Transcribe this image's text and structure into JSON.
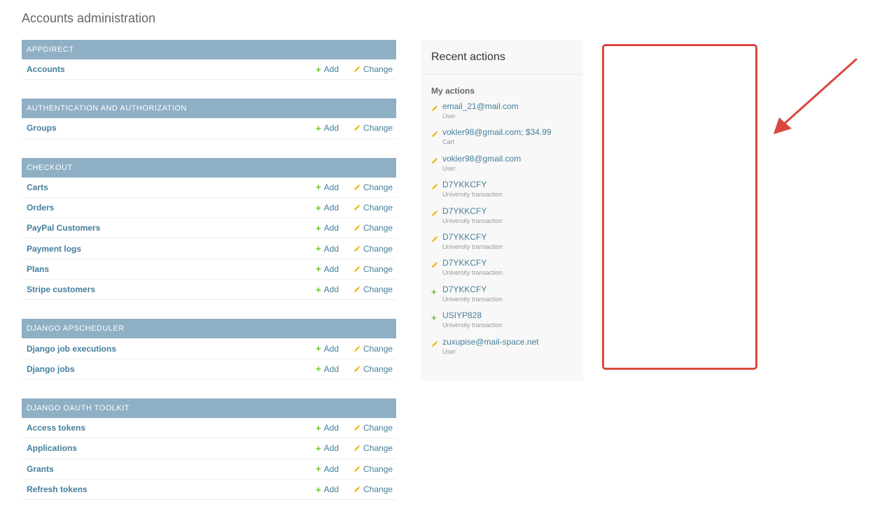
{
  "page": {
    "title": "Accounts administration"
  },
  "labels": {
    "add": "Add",
    "change": "Change"
  },
  "modules": [
    {
      "header": "APPDIRECT",
      "models": [
        "Accounts"
      ]
    },
    {
      "header": "AUTHENTICATION AND AUTHORIZATION",
      "models": [
        "Groups"
      ]
    },
    {
      "header": "CHECKOUT",
      "models": [
        "Carts",
        "Orders",
        "PayPal Customers",
        "Payment logs",
        "Plans",
        "Stripe customers"
      ]
    },
    {
      "header": "DJANGO APSCHEDULER",
      "models": [
        "Django job executions",
        "Django jobs"
      ]
    },
    {
      "header": "DJANGO OAUTH TOOLKIT",
      "models": [
        "Access tokens",
        "Applications",
        "Grants",
        "Refresh tokens"
      ]
    }
  ],
  "recent": {
    "title": "Recent actions",
    "subtitle": "My actions",
    "items": [
      {
        "icon": "pencil-icon",
        "text": "email_21@mail.com",
        "type": "User"
      },
      {
        "icon": "pencil-icon",
        "text": "vokler98@gmail.com; $34.99",
        "type": "Cart"
      },
      {
        "icon": "pencil-icon",
        "text": "vokler98@gmail.com",
        "type": "User"
      },
      {
        "icon": "pencil-icon",
        "text": "D7YKKCFY",
        "type": "University transaction"
      },
      {
        "icon": "pencil-icon",
        "text": "D7YKKCFY",
        "type": "University transaction"
      },
      {
        "icon": "pencil-icon",
        "text": "D7YKKCFY",
        "type": "University transaction"
      },
      {
        "icon": "pencil-icon",
        "text": "D7YKKCFY",
        "type": "University transaction"
      },
      {
        "icon": "plus-icon",
        "text": "D7YKKCFY",
        "type": "University transaction"
      },
      {
        "icon": "plus-icon",
        "text": "USIYP828",
        "type": "University transaction"
      },
      {
        "icon": "pencil-icon",
        "text": "zuxupise@mail-space.net",
        "type": "User"
      }
    ]
  },
  "colors": {
    "module_header": "#8fafc5",
    "link": "#447e9b",
    "add_green": "#70bf2b",
    "change_yellow": "#efb80b",
    "annotation_red": "#d9473e"
  }
}
